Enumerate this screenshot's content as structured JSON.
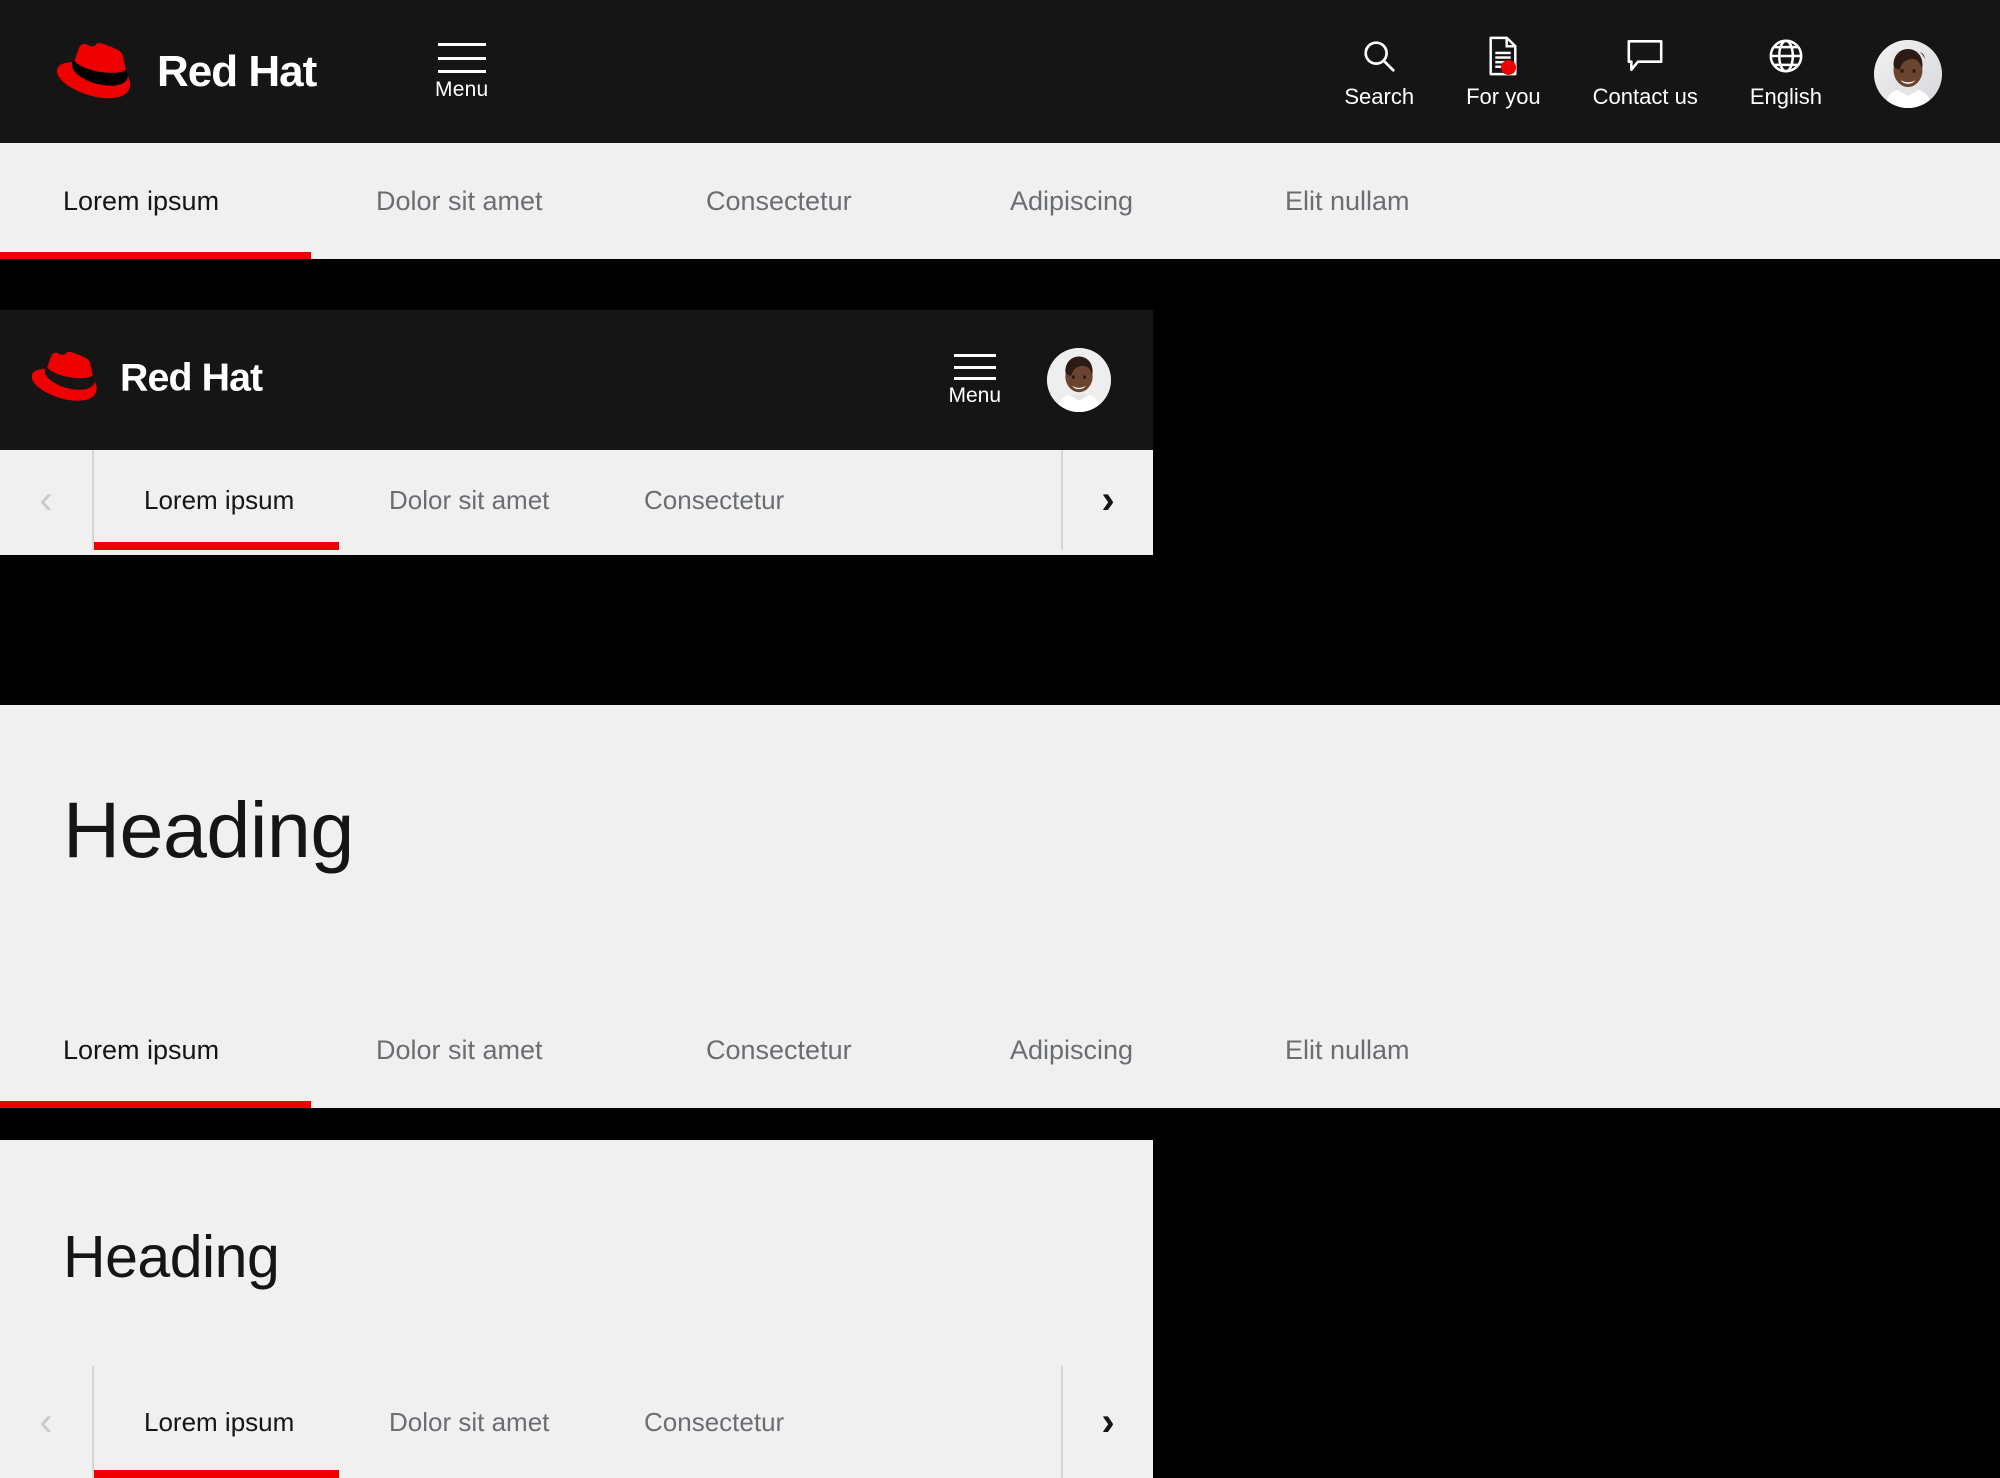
{
  "brand": {
    "name": "Red Hat",
    "logo_icon": "red-hat-fedora-logo",
    "accent_color": "#ee0000"
  },
  "masthead": {
    "menu": {
      "label": "Menu",
      "icon": "hamburger-menu-icon"
    },
    "utilities": [
      {
        "label": "Search",
        "icon": "search-icon"
      },
      {
        "label": "For you",
        "icon": "document-icon",
        "badge": true
      },
      {
        "label": "Contact us",
        "icon": "chat-bubble-icon"
      },
      {
        "label": "English",
        "icon": "globe-icon"
      }
    ],
    "avatar": {
      "icon": "user-avatar",
      "alt": "User profile photo"
    }
  },
  "primary_tabs": {
    "items": [
      {
        "label": "Lorem ipsum",
        "active": true
      },
      {
        "label": "Dolor sit amet",
        "active": false
      },
      {
        "label": "Consectetur",
        "active": false
      },
      {
        "label": "Adipiscing",
        "active": false
      },
      {
        "label": "Elit nullam",
        "active": false
      }
    ]
  },
  "mobile_card_top": {
    "menu": {
      "label": "Menu",
      "icon": "hamburger-menu-icon"
    },
    "avatar": {
      "icon": "user-avatar"
    },
    "prev_arrow": {
      "icon": "chevron-left-icon",
      "glyph": "‹",
      "enabled": false
    },
    "next_arrow": {
      "icon": "chevron-right-icon",
      "glyph": "›",
      "enabled": true
    },
    "tabs": [
      {
        "label": "Lorem ipsum",
        "active": true
      },
      {
        "label": "Dolor sit amet",
        "active": false
      },
      {
        "label": "Consectetur",
        "active": false
      }
    ]
  },
  "section_desktop": {
    "heading": "Heading",
    "tabs": [
      {
        "label": "Lorem ipsum",
        "active": true
      },
      {
        "label": "Dolor sit amet",
        "active": false
      },
      {
        "label": "Consectetur",
        "active": false
      },
      {
        "label": "Adipiscing",
        "active": false
      },
      {
        "label": "Elit nullam",
        "active": false
      }
    ]
  },
  "mobile_card_bottom": {
    "heading": "Heading",
    "prev_arrow": {
      "icon": "chevron-left-icon",
      "glyph": "‹",
      "enabled": false
    },
    "next_arrow": {
      "icon": "chevron-right-icon",
      "glyph": "›",
      "enabled": true
    },
    "tabs": [
      {
        "label": "Lorem ipsum",
        "active": true
      },
      {
        "label": "Dolor sit amet",
        "active": false
      },
      {
        "label": "Consectetur",
        "active": false
      }
    ]
  },
  "colors": {
    "black": "#000000",
    "masthead_bg": "#151515",
    "surface_light": "#f0f0f0",
    "accent_red": "#ee0000",
    "text_muted": "#6a6e73",
    "text_dark": "#151515"
  }
}
